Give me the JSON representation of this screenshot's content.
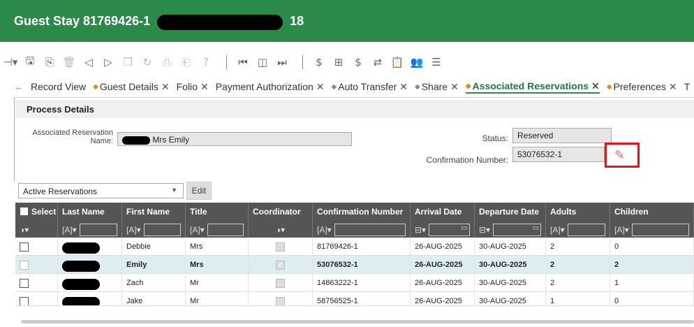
{
  "header": {
    "title": "Guest Stay 81769426-1",
    "suffix": "18",
    "bg_color": "#2b8a4a"
  },
  "toolbar": {
    "icons": [
      "collapse-icon",
      "save-icon",
      "new-icon",
      "delete-icon",
      "prev-icon",
      "next-icon",
      "copy-icon",
      "refresh-icon",
      "print-icon",
      "export-icon",
      "help-icon",
      "first-icon",
      "split-icon",
      "last-icon",
      "deposit-icon",
      "post-icon",
      "dollar-icon",
      "transfer-icon",
      "clipboard-icon",
      "profile-icon",
      "list-icon"
    ]
  },
  "tabs": [
    {
      "label": "Record View",
      "star": false,
      "close": false
    },
    {
      "label": "Guest Details",
      "star": true,
      "close": true
    },
    {
      "label": "Folio",
      "star": false,
      "close": true
    },
    {
      "label": "Payment Authorization",
      "star": false,
      "close": true
    },
    {
      "label": "Auto Transfer",
      "star": true,
      "close": true
    },
    {
      "label": "Share",
      "star": true,
      "close": true
    },
    {
      "label": "Associated Reservations",
      "star": true,
      "close": true,
      "active": true
    },
    {
      "label": "Preferences",
      "star": true,
      "close": true
    },
    {
      "label": "T",
      "star": false,
      "close": false
    }
  ],
  "process": {
    "section_title": "Process Details",
    "assoc_label": "Associated Reservation Name:",
    "assoc_value": "Mrs Emily",
    "status_label": "Status:",
    "status_value": "Reserved",
    "conf_label": "Confirmation Number:",
    "conf_value": "53076532-1"
  },
  "filter": {
    "selected": "Active Reservations",
    "edit_label": "Edit"
  },
  "grid": {
    "columns": [
      "Select",
      "Last Name",
      "First Name",
      "Title",
      "Coordinator",
      "Confirmation Number",
      "Arrival Date",
      "Departure Date",
      "Adults",
      "Children"
    ],
    "rows": [
      {
        "first": "Debbie",
        "title": "Mrs",
        "conf": "81769426-1",
        "arrival": "26-AUG-2025",
        "departure": "30-AUG-2025",
        "adults": "2",
        "children": "0",
        "coordinator": false,
        "selected": false
      },
      {
        "first": "Emily",
        "title": "Mrs",
        "conf": "53076532-1",
        "arrival": "26-AUG-2025",
        "departure": "30-AUG-2025",
        "adults": "2",
        "children": "2",
        "coordinator": true,
        "selected": true
      },
      {
        "first": "Zach",
        "title": "Mr",
        "conf": "14863222-1",
        "arrival": "26-AUG-2025",
        "departure": "30-AUG-2025",
        "adults": "2",
        "children": "1",
        "coordinator": false,
        "selected": false
      },
      {
        "first": "Jake",
        "title": "Mr",
        "conf": "58756525-1",
        "arrival": "26-AUG-2025",
        "departure": "30-AUG-2025",
        "adults": "1",
        "children": "0",
        "coordinator": false,
        "selected": false
      }
    ]
  }
}
